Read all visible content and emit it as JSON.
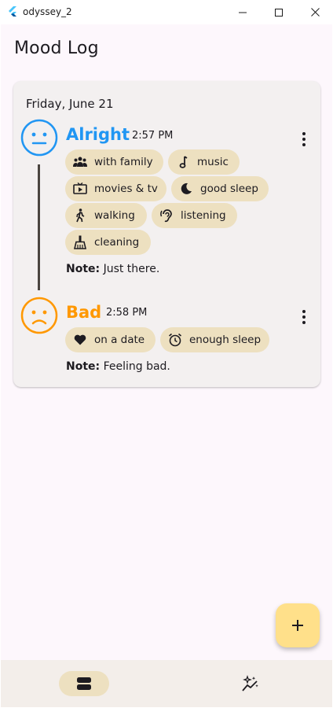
{
  "window": {
    "title": "odyssey_2"
  },
  "app": {
    "title": "Mood Log"
  },
  "colors": {
    "alright": "#2196f3",
    "bad": "#ff9800",
    "chip": "#ede0c0",
    "fab": "#ffe08a"
  },
  "day": {
    "date": "Friday, June 21",
    "entries": [
      {
        "mood": "Alright",
        "time": "2:57 PM",
        "face_icon": "neutral-face-icon",
        "activities": [
          {
            "label": "with family",
            "icon": "family-icon"
          },
          {
            "label": "music",
            "icon": "music-note-icon"
          },
          {
            "label": "movies & tv",
            "icon": "tv-icon"
          },
          {
            "label": "good sleep",
            "icon": "moon-icon"
          },
          {
            "label": "walking",
            "icon": "walking-icon"
          },
          {
            "label": "listening",
            "icon": "ear-icon"
          },
          {
            "label": "cleaning",
            "icon": "broom-icon"
          }
        ],
        "note_label": "Note:",
        "note_text": " Just there."
      },
      {
        "mood": "Bad",
        "time": "2:58 PM",
        "face_icon": "sad-face-icon",
        "activities": [
          {
            "label": "on a date",
            "icon": "heart-icon"
          },
          {
            "label": "enough sleep",
            "icon": "alarm-clock-icon"
          }
        ],
        "note_label": "Note:",
        "note_text": " Feeling bad."
      }
    ]
  },
  "fab": {
    "icon": "plus-icon"
  },
  "nav": {
    "items": [
      {
        "icon": "log-list-icon",
        "active": true
      },
      {
        "icon": "insights-icon",
        "active": false
      }
    ]
  }
}
